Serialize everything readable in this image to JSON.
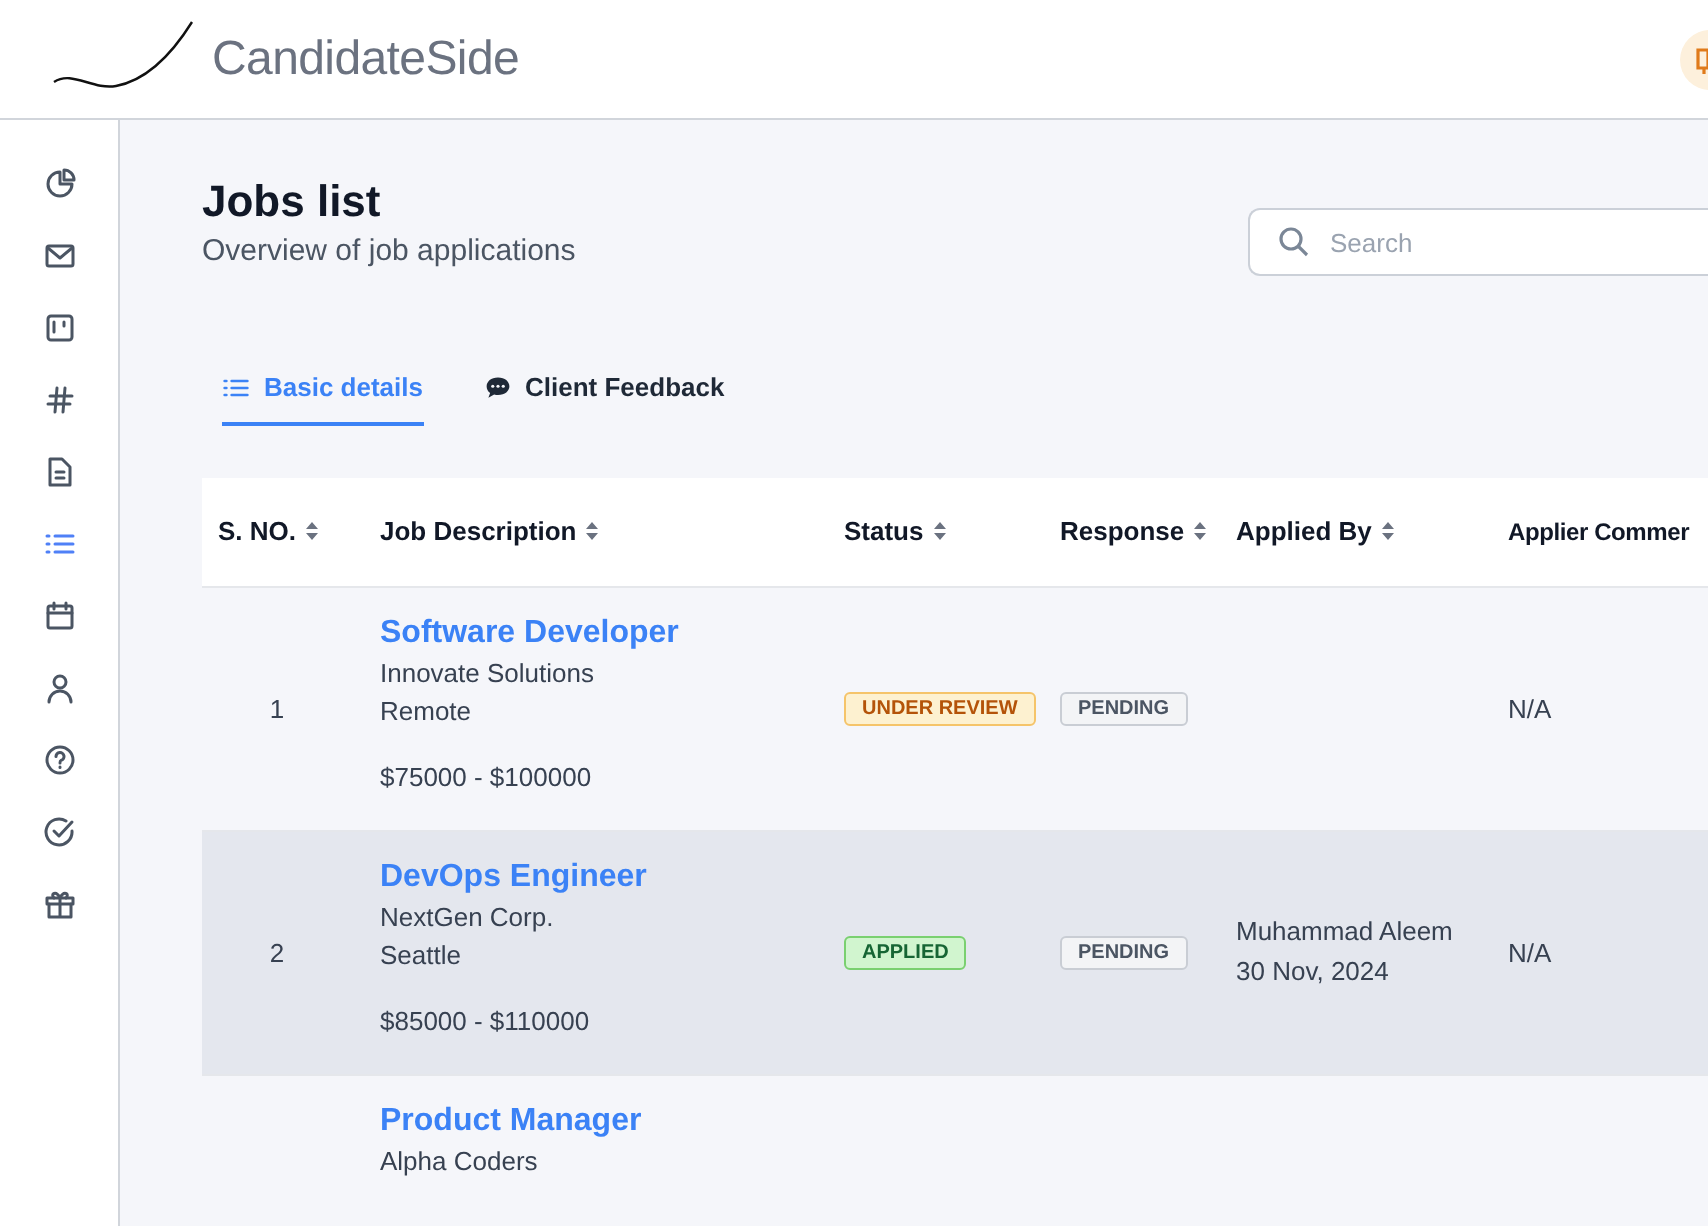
{
  "header": {
    "brand": "CandidateSide"
  },
  "sidebar": {
    "items": [
      {
        "selected": false
      },
      {
        "selected": false
      },
      {
        "selected": false
      },
      {
        "selected": false
      },
      {
        "selected": false
      },
      {
        "selected": true
      },
      {
        "selected": false
      },
      {
        "selected": false
      },
      {
        "selected": false
      },
      {
        "selected": false
      },
      {
        "selected": false
      }
    ]
  },
  "page": {
    "title": "Jobs list",
    "subtitle": "Overview of job applications"
  },
  "search": {
    "placeholder": "Search"
  },
  "tabs": [
    {
      "label": "Basic details",
      "selected": true
    },
    {
      "label": "Client Feedback",
      "selected": false
    }
  ],
  "table": {
    "columns": [
      "S. NO.",
      "Job Description",
      "Status",
      "Response",
      "Applied By",
      "Applier Commer"
    ],
    "rows": [
      {
        "number": "1",
        "title": "Software Developer",
        "company": "Innovate Solutions",
        "location": "Remote",
        "salary": "$75000 - $100000",
        "status": {
          "label": "UNDER REVIEW",
          "kind": "review"
        },
        "response": {
          "label": "PENDING",
          "kind": "pending"
        },
        "applied_by": [],
        "comment": "N/A",
        "highlighted": false
      },
      {
        "number": "2",
        "title": "DevOps Engineer",
        "company": "NextGen Corp.",
        "location": "Seattle",
        "salary": "$85000 - $110000",
        "status": {
          "label": "APPLIED",
          "kind": "applied"
        },
        "response": {
          "label": "PENDING",
          "kind": "pending"
        },
        "applied_by": [
          "Muhammad Aleem",
          "30 Nov, 2024"
        ],
        "comment": "N/A",
        "highlighted": true
      },
      {
        "title": "Product Manager",
        "company": "Alpha Coders",
        "highlighted": false
      }
    ]
  }
}
